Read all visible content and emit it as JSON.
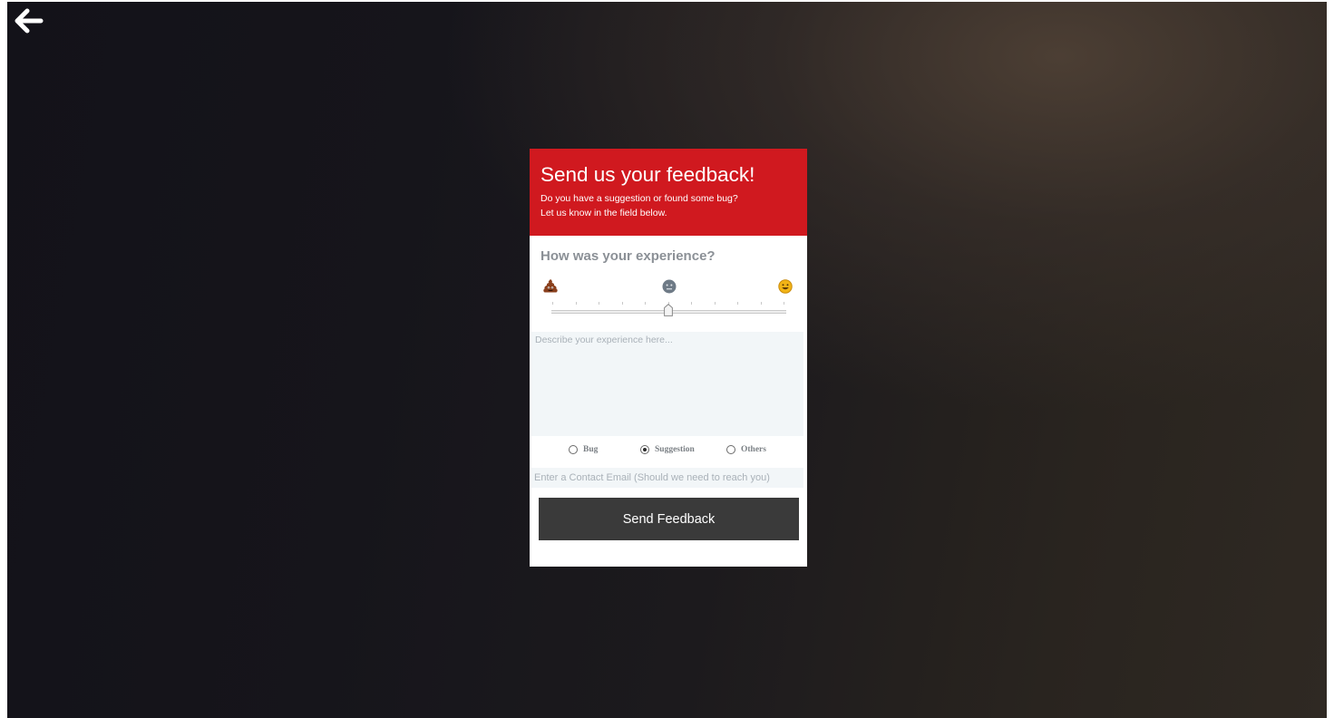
{
  "nav": {
    "back_icon": "arrow-left-icon"
  },
  "feedback": {
    "title": "Send us your feedback!",
    "subtitle_line1": "Do you have a suggestion or found some bug?",
    "subtitle_line2": "Let us know in the field below.",
    "question": "How was your experience?",
    "rating": {
      "icons": [
        "poop-emoji-icon",
        "neutral-face-icon",
        "smiling-face-icon"
      ],
      "min": 0,
      "max": 10,
      "value": 5
    },
    "description_placeholder": "Describe your experience here...",
    "description_value": "",
    "categories": [
      {
        "label": "Bug",
        "checked": false
      },
      {
        "label": "Suggestion",
        "checked": true
      },
      {
        "label": "Others",
        "checked": false
      }
    ],
    "email_placeholder": "Enter a Contact Email (Should we need to reach you)",
    "email_value": "",
    "submit_label": "Send Feedback"
  },
  "colors": {
    "header_bg": "#d0191f",
    "button_bg": "#3a3a3a",
    "input_bg": "#f2f6f8"
  }
}
